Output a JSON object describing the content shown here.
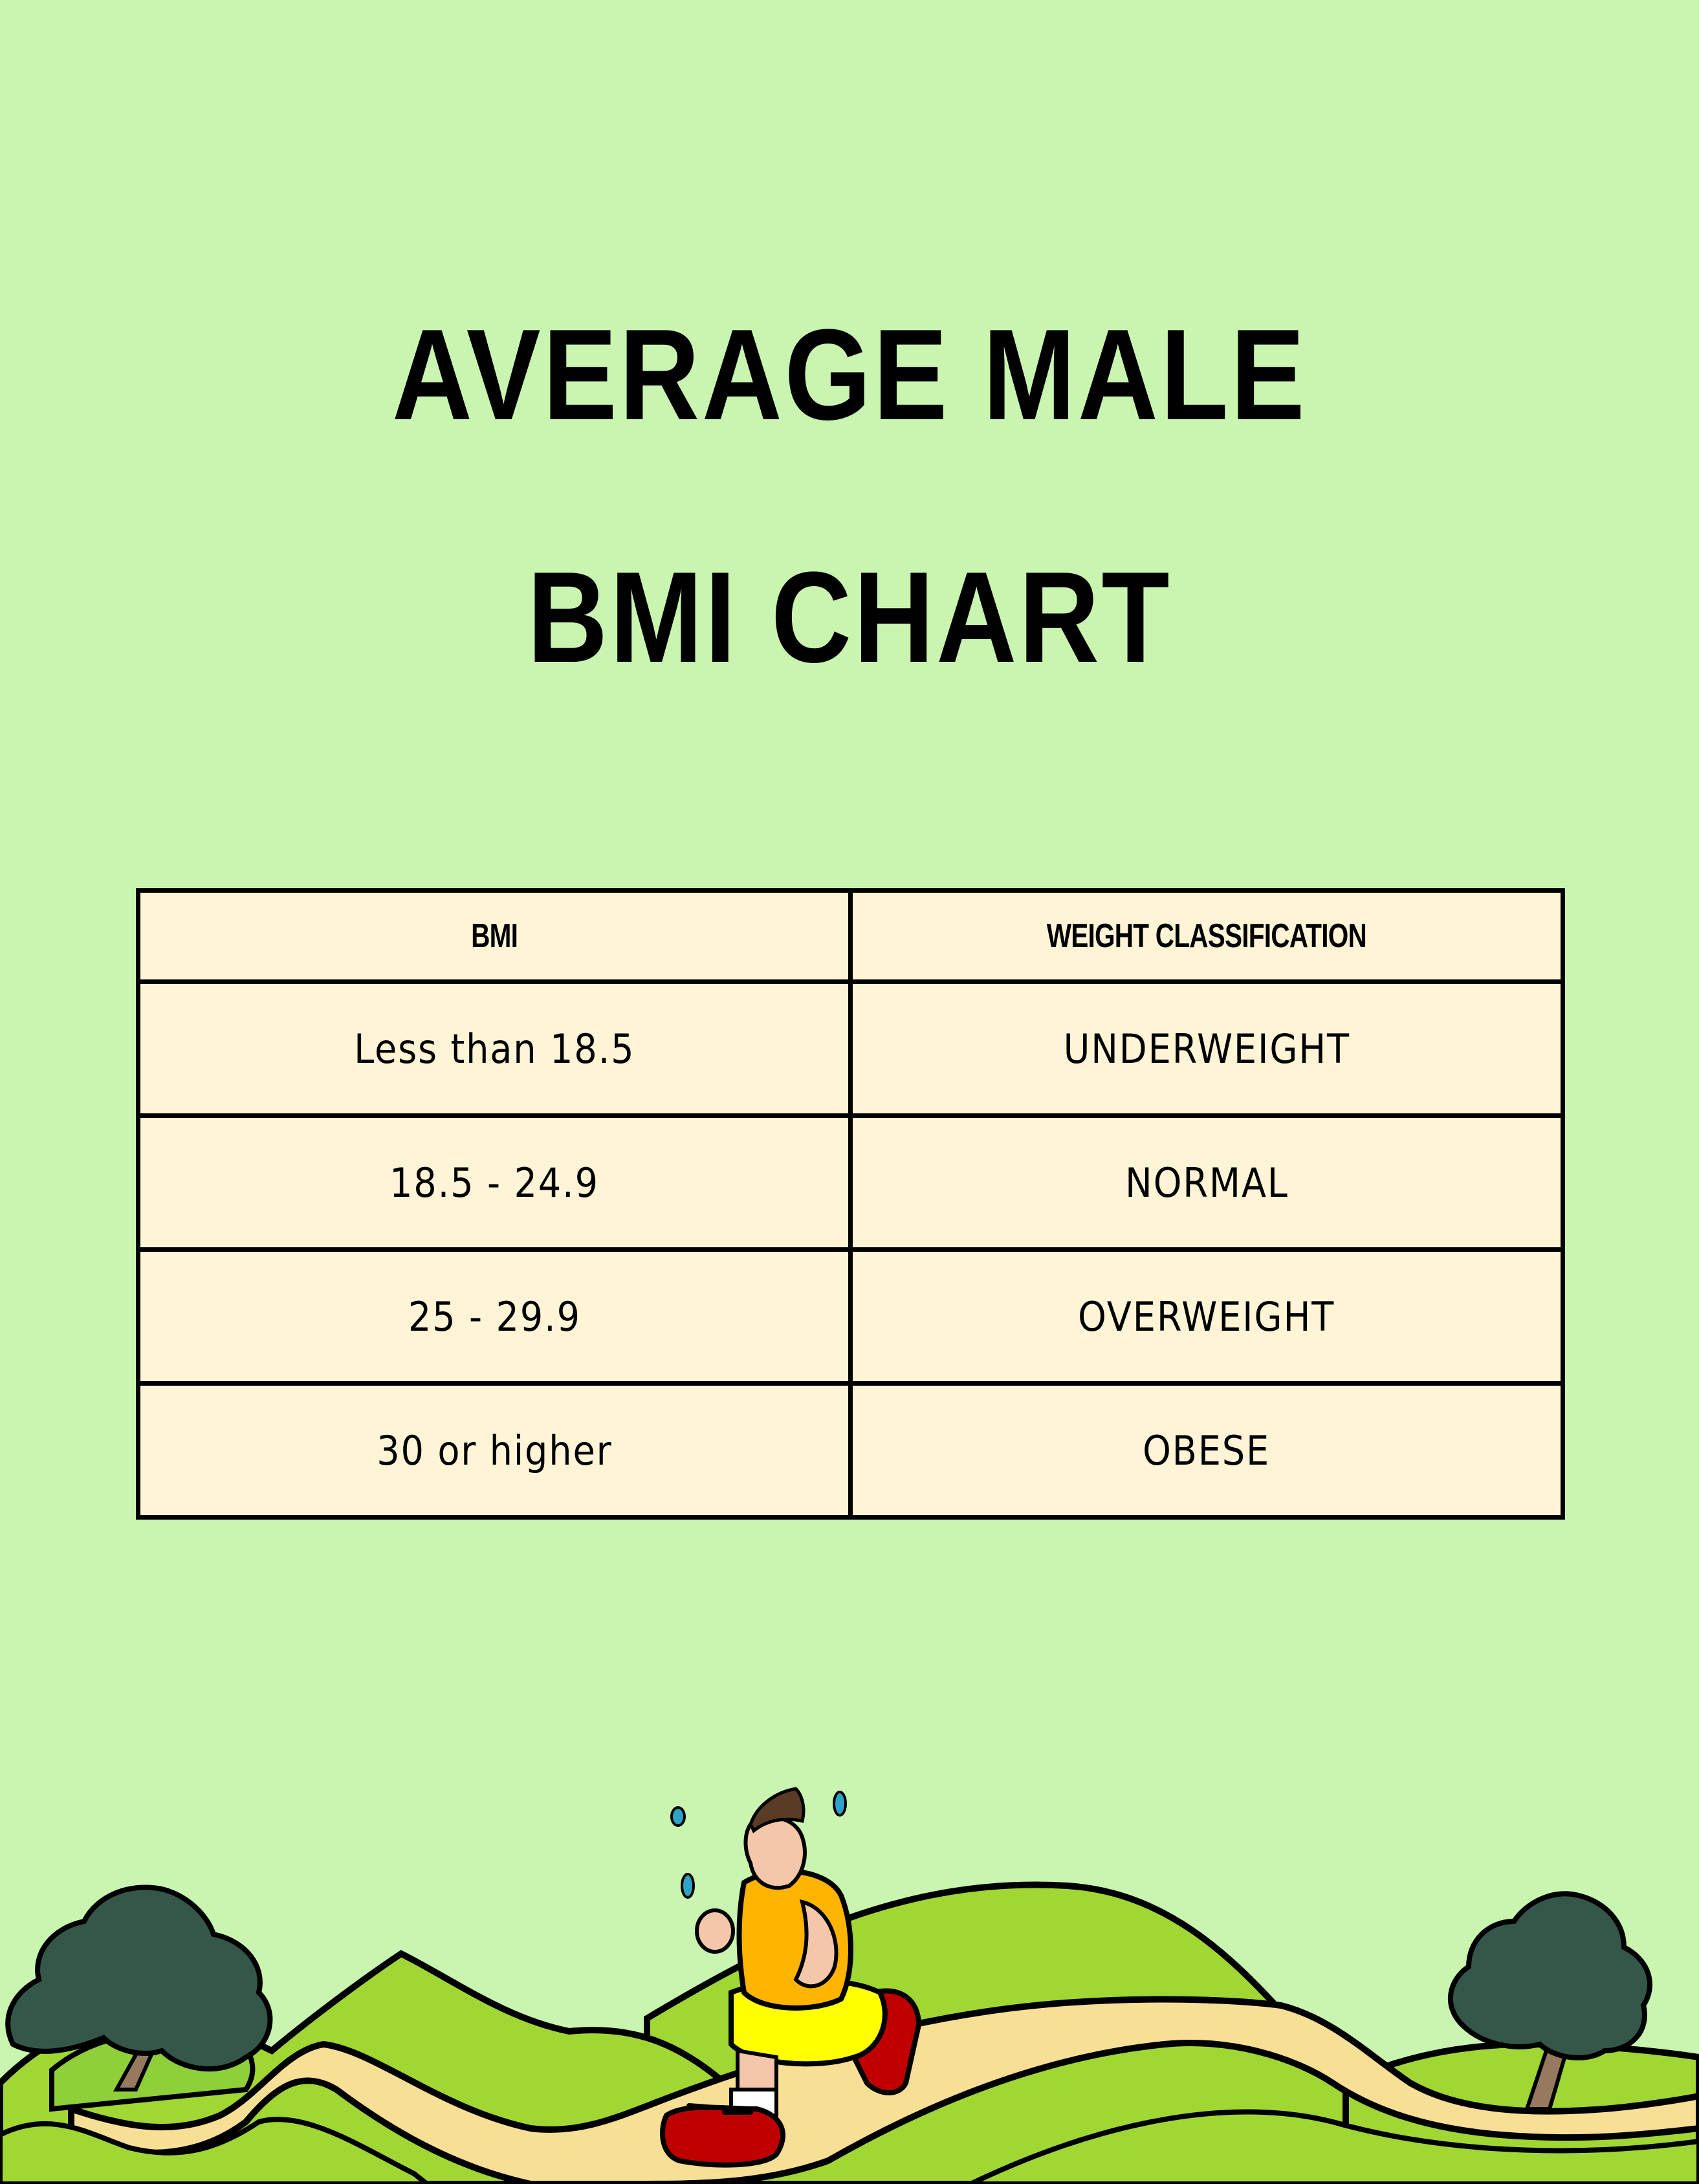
{
  "title": {
    "line1": "AVERAGE MALE",
    "line2": "BMI CHART"
  },
  "table": {
    "headers": [
      "BMI",
      "WEIGHT CLASSIFICATION"
    ],
    "rows": [
      {
        "bmi": "Less than 18.5",
        "classification": "UNDERWEIGHT"
      },
      {
        "bmi": "18.5 - 24.9",
        "classification": "NORMAL"
      },
      {
        "bmi": "25 - 29.9",
        "classification": "OVERWEIGHT"
      },
      {
        "bmi": "30 or higher",
        "classification": "OBESE"
      }
    ]
  },
  "illustration": {
    "subject": "jogging-man-on-hills-illustration",
    "elements": [
      "tree-icon",
      "hills",
      "path",
      "runner",
      "sweat-drops",
      "tree-icon"
    ]
  },
  "colors": {
    "background": "#caf5b0",
    "table_fill": "#fff5d6",
    "border": "#000000",
    "hill_light": "#a1d733",
    "hill_mid": "#8fcf3a",
    "path": "#f7df96",
    "tree_foliage": "#35574a",
    "tree_trunk": "#957a5f",
    "shirt": "#ffb400",
    "shorts": "#ffff00",
    "shoes": "#c00000",
    "skin": "#f5c7aa",
    "hair": "#5a3c24",
    "sweat": "#2ea3c9"
  }
}
